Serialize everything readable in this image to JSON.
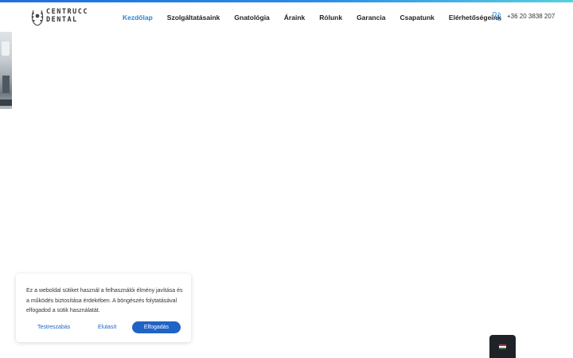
{
  "header": {
    "logo": {
      "line1": "CENTRUCC",
      "line2": "DENTAL"
    },
    "nav": [
      {
        "label": "Kezdőlap",
        "active": true
      },
      {
        "label": "Szolgáltatásaink"
      },
      {
        "label": "Gnatológia"
      },
      {
        "label": "Áraink"
      },
      {
        "label": "Rólunk"
      },
      {
        "label": "Garancia"
      },
      {
        "label": "Csapatunk"
      },
      {
        "label": "Elérhetőségeink"
      }
    ],
    "phone": {
      "icon": "phone-icon",
      "number": "+36 20 3838 207"
    }
  },
  "colors": {
    "accent": "#2a86d6",
    "button": "#1f63c6",
    "lang_bg": "#1f2328"
  },
  "cookie": {
    "text": "Ez a weboldal sütiket használ a felhasználói élmény javítása és a működés biztosítása érdekében. A böngészés folytatásával elfogadod a sütik használatát.",
    "customize_label": "Testreszabás",
    "decline_label": "Elutasít",
    "accept_label": "Elfogadás"
  },
  "language": {
    "icon": "hungary-flag-icon",
    "colors": [
      "#ce2939",
      "#ffffff",
      "#477050"
    ]
  }
}
